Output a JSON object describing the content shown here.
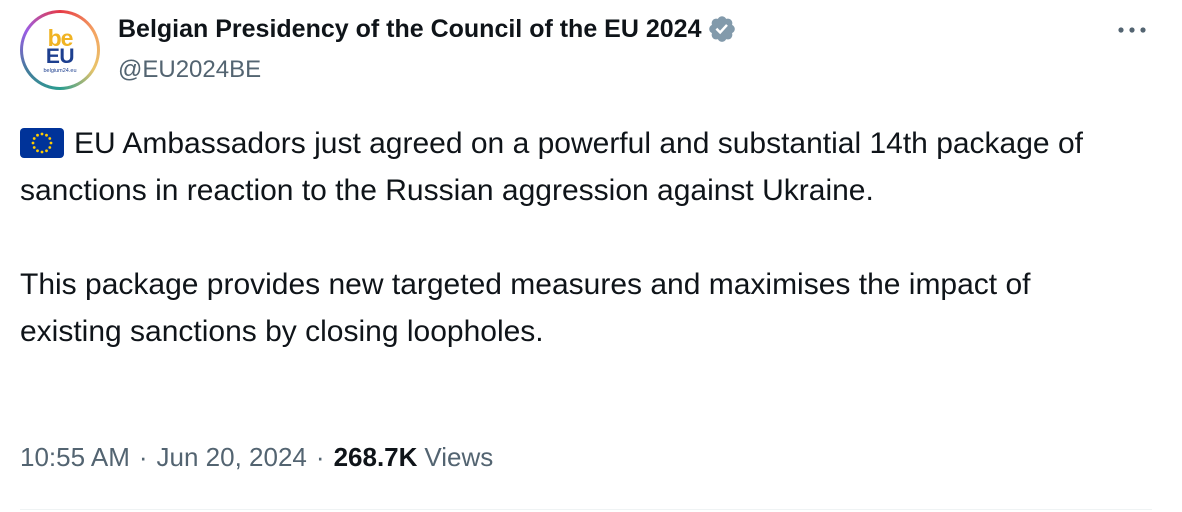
{
  "author": {
    "display_name": "Belgian Presidency of the Council of the EU 2024",
    "handle": "@EU2024BE",
    "avatar_logo": {
      "line1": "be",
      "line2": "EU",
      "line3": "belgium24.eu"
    },
    "verified_icon": "verified-badge-icon"
  },
  "tweet": {
    "paragraph1": "EU Ambassadors just agreed on a powerful and substantial 14th package of sanctions in reaction to the Russian aggression against Ukraine.",
    "paragraph2": "This package provides new targeted measures and maximises the impact of existing sanctions by closing loopholes.",
    "emoji": "eu-flag-icon"
  },
  "meta": {
    "time": "10:55 AM",
    "separator": "·",
    "date": "Jun 20, 2024",
    "views_count": "268.7K",
    "views_label": "Views"
  },
  "colors": {
    "text_primary": "#0f1419",
    "text_secondary": "#536471",
    "verified_badge": "#829aab",
    "eu_flag_blue": "#003399",
    "eu_flag_star": "#ffcc00"
  }
}
